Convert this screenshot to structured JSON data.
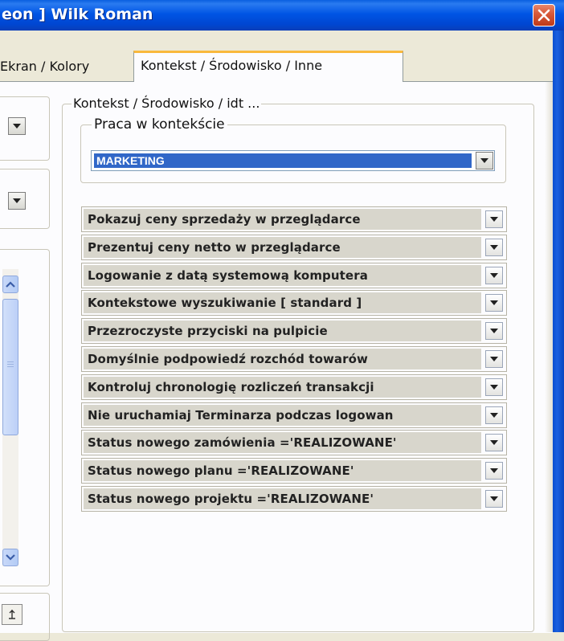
{
  "window": {
    "title": "eon ] Wilk Roman"
  },
  "tabs": [
    {
      "label": "Ekran / Kolory"
    },
    {
      "label": "Kontekst / Środowisko / Inne"
    }
  ],
  "context_group": {
    "legend": "Kontekst / Środowisko / idt ...",
    "work_context": {
      "legend": "Praca w kontekście",
      "selected": "MARKETING"
    }
  },
  "options": [
    {
      "label": "Pokazuj ceny sprzedaży w przeglądarce"
    },
    {
      "label": "Prezentuj ceny netto w przeglądarce"
    },
    {
      "label": "Logowanie z datą systemową komputera"
    },
    {
      "label": "Kontekstowe wyszukiwanie [ standard ]"
    },
    {
      "label": "Przezroczyste przyciski na pulpicie"
    },
    {
      "label": "Domyślnie podpowiedź rozchód towarów"
    },
    {
      "label": "Kontroluj chronologię rozliczeń transakcji"
    },
    {
      "label": "Nie uruchamiaj Terminarza podczas logowan"
    },
    {
      "label": "Status nowego zamówienia ='REALIZOWANE'"
    },
    {
      "label": "Status nowego planu ='REALIZOWANE'"
    },
    {
      "label": "Status nowego projektu ='REALIZOWANE'"
    }
  ],
  "colors": {
    "titlebar": "#0055e5",
    "selection": "#3167c8",
    "close_button": "#d95b3c",
    "option_background": "#d8d6cc"
  },
  "icons": {
    "close": "close-icon",
    "dropdown": "chevron-down-icon",
    "scroll_up": "arrow-up-icon",
    "scroll_down": "arrow-down-icon"
  }
}
